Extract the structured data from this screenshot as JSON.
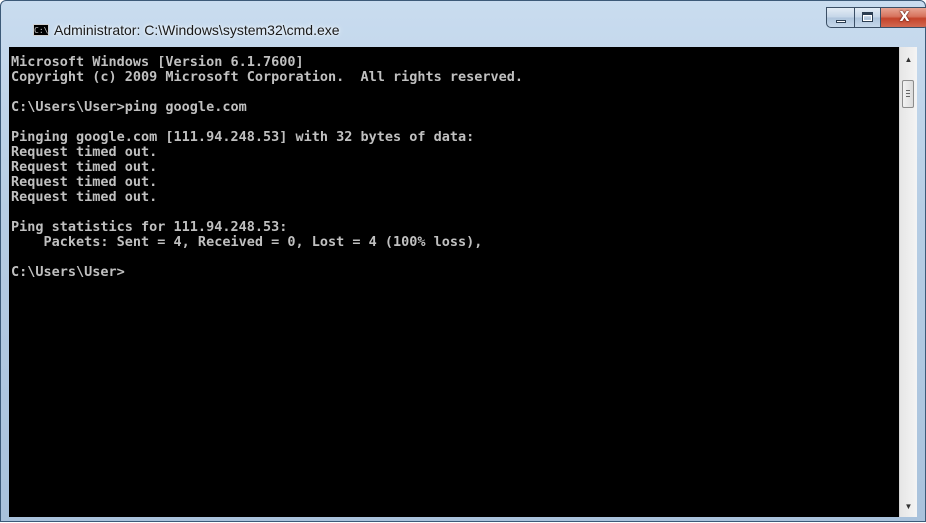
{
  "window": {
    "title": "Administrator: C:\\Windows\\system32\\cmd.exe",
    "app_icon_text": "C:\\",
    "close_glyph": "X"
  },
  "console": {
    "lines": [
      "Microsoft Windows [Version 6.1.7600]",
      "Copyright (c) 2009 Microsoft Corporation.  All rights reserved.",
      "",
      "C:\\Users\\User>ping google.com",
      "",
      "Pinging google.com [111.94.248.53] with 32 bytes of data:",
      "Request timed out.",
      "Request timed out.",
      "Request timed out.",
      "Request timed out.",
      "",
      "Ping statistics for 111.94.248.53:",
      "    Packets: Sent = 4, Received = 0, Lost = 4 (100% loss),",
      "",
      "C:\\Users\\User>"
    ],
    "text_color": "#c0c0c0",
    "background_color": "#000000"
  },
  "scrollbar": {
    "up_arrow": "▲",
    "down_arrow": "▼"
  },
  "icons": {
    "app": "cmd-console-icon",
    "minimize": "minimize-icon",
    "maximize": "maximize-icon",
    "close": "close-icon"
  }
}
